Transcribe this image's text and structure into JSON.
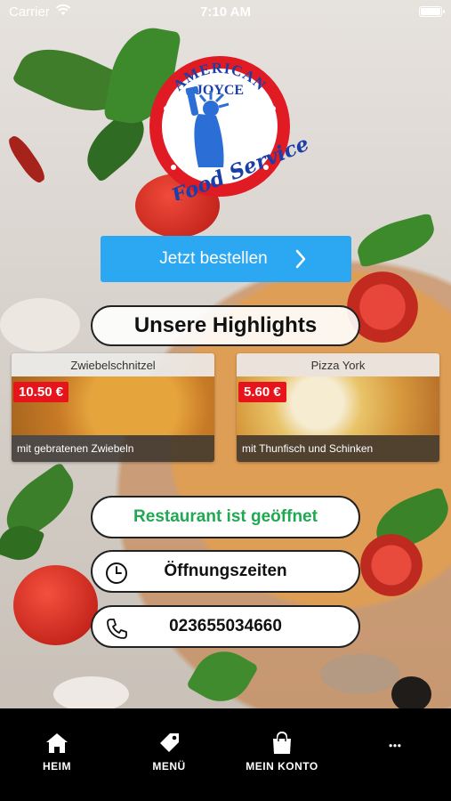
{
  "status_bar": {
    "carrier": "Carrier",
    "time": "7:10 AM"
  },
  "logo": {
    "top_text": "AMERICAN",
    "name": "JOYCE",
    "script_text": "Food Service",
    "colors": {
      "ring": "#e01b24",
      "text": "#1b3fa8",
      "statue": "#2b6fd6"
    }
  },
  "order_button": {
    "label": "Jetzt bestellen",
    "icon": "chevron-right-icon"
  },
  "highlights": {
    "title": "Unsere Highlights",
    "items": [
      {
        "name": "Zwiebelschnitzel",
        "price": "10.50 €",
        "description": "mit gebratenen Zwiebeln"
      },
      {
        "name": "Pizza York",
        "price": "5.60 €",
        "description": "mit Thunfisch und Schinken"
      }
    ]
  },
  "open_status": {
    "label": "Restaurant ist geöffnet",
    "color": "#20a852"
  },
  "hours_button": {
    "label": "Öffnungszeiten",
    "icon": "clock-icon"
  },
  "phone_button": {
    "label": "023655034660",
    "icon": "phone-icon"
  },
  "tab_bar": {
    "items": [
      {
        "label": "HEIM",
        "icon": "home-icon"
      },
      {
        "label": "MENÜ",
        "icon": "tag-icon"
      },
      {
        "label": "MEIN KONTO",
        "icon": "shopping-bag-icon"
      },
      {
        "label": "",
        "icon": "more-dots-icon"
      }
    ]
  },
  "colors": {
    "accent_blue": "#2ba8f1",
    "price_red": "#e8141c",
    "open_green": "#20a852",
    "tab_bar_bg": "#000000"
  }
}
